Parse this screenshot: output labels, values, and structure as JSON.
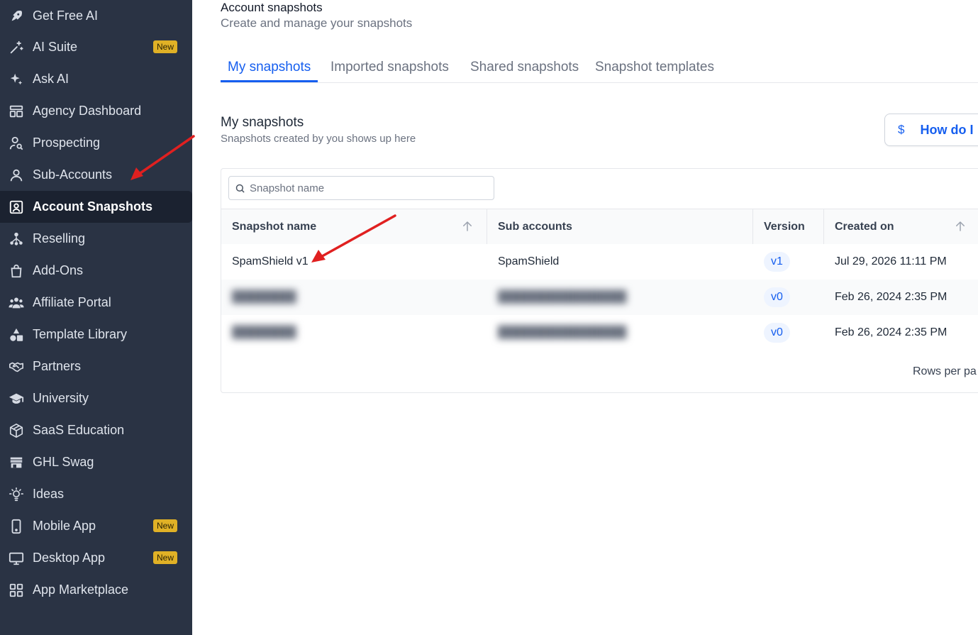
{
  "sidebar": {
    "items": [
      {
        "label": "Get Free AI",
        "icon": "rocket-icon"
      },
      {
        "label": "AI Suite",
        "icon": "sparkle-wand-icon",
        "badge": "New"
      },
      {
        "label": "Ask AI",
        "icon": "sparkles-icon"
      },
      {
        "label": "Agency Dashboard",
        "icon": "dashboard-icon"
      },
      {
        "label": "Prospecting",
        "icon": "user-search-icon"
      },
      {
        "label": "Sub-Accounts",
        "icon": "user-icon"
      },
      {
        "label": "Account Snapshots",
        "icon": "user-square-icon",
        "active": true
      },
      {
        "label": "Reselling",
        "icon": "network-icon"
      },
      {
        "label": "Add-Ons",
        "icon": "shopping-bag-icon"
      },
      {
        "label": "Affiliate Portal",
        "icon": "users-icon"
      },
      {
        "label": "Template Library",
        "icon": "shapes-icon"
      },
      {
        "label": "Partners",
        "icon": "handshake-icon"
      },
      {
        "label": "University",
        "icon": "graduation-cap-icon"
      },
      {
        "label": "SaaS Education",
        "icon": "box-icon"
      },
      {
        "label": "GHL Swag",
        "icon": "store-icon"
      },
      {
        "label": "Ideas",
        "icon": "lightbulb-icon"
      },
      {
        "label": "Mobile App",
        "icon": "mobile-icon",
        "badge": "New"
      },
      {
        "label": "Desktop App",
        "icon": "monitor-icon",
        "badge": "New"
      },
      {
        "label": "App Marketplace",
        "icon": "grid-icon"
      }
    ]
  },
  "header": {
    "title": "Account snapshots",
    "subtitle": "Create and manage your snapshots"
  },
  "tabs": [
    {
      "label": "My snapshots",
      "active": true
    },
    {
      "label": "Imported snapshots"
    },
    {
      "label": "Shared snapshots"
    },
    {
      "label": "Snapshot templates"
    }
  ],
  "section": {
    "title": "My snapshots",
    "subtitle": "Snapshots created by you shows up here",
    "help_button": {
      "icon_text": "$",
      "label": "How do I"
    }
  },
  "search": {
    "placeholder": "Snapshot name",
    "value": ""
  },
  "table": {
    "columns": [
      "Snapshot name",
      "Sub accounts",
      "Version",
      "Created on"
    ],
    "rows": [
      {
        "name": "SpamShield v1",
        "sub_accounts": "SpamShield",
        "version": "v1",
        "created_on": "Jul 29, 2026 11:11 PM",
        "blurred": false
      },
      {
        "name": "",
        "sub_accounts": "",
        "version": "v0",
        "created_on": "Feb 26, 2024 2:35 PM",
        "blurred": true
      },
      {
        "name": "",
        "sub_accounts": "",
        "version": "v0",
        "created_on": "Feb 26, 2024 2:35 PM",
        "blurred": true
      }
    ]
  },
  "pagination": {
    "rows_per_page_label": "Rows per pa"
  },
  "colors": {
    "sidebar_bg": "#2a3344",
    "sidebar_active_bg": "#1b2230",
    "accent": "#155eef",
    "badge": "#e0b126",
    "annotation_arrow": "#e02020"
  }
}
